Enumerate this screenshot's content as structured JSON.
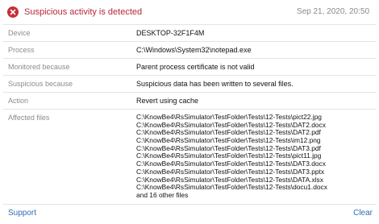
{
  "alert": {
    "title": "Suspicious activity is detected",
    "timestamp": "Sep 21, 2020, 20:50",
    "icon": "error-x-icon",
    "accent_color": "#c62f3a"
  },
  "details": {
    "device": {
      "label": "Device",
      "value": "DESKTOP-32F1F4M"
    },
    "process": {
      "label": "Process",
      "value": "C:\\Windows\\System32\\notepad.exe"
    },
    "monitored": {
      "label": "Monitored because",
      "value": "Parent process certificate is not valid"
    },
    "suspicious": {
      "label": "Suspicious because",
      "value": "Suspicious data has been written to several files."
    },
    "action": {
      "label": "Action",
      "value": "Revert using cache"
    },
    "affected": {
      "label": "Affected files",
      "files": [
        "C:\\KnowBe4\\RsSimulator\\TestFolder\\Tests\\12-Tests\\pict22.jpg",
        "C:\\KnowBe4\\RsSimulator\\TestFolder\\Tests\\12-Tests\\DAT2.docx",
        "C:\\KnowBe4\\RsSimulator\\TestFolder\\Tests\\12-Tests\\DAT2.pdf",
        "C:\\KnowBe4\\RsSimulator\\TestFolder\\Tests\\12-Tests\\im12.png",
        "C:\\KnowBe4\\RsSimulator\\TestFolder\\Tests\\12-Tests\\DAT3.pdf",
        "C:\\KnowBe4\\RsSimulator\\TestFolder\\Tests\\12-Tests\\pict11.jpg",
        "C:\\KnowBe4\\RsSimulator\\TestFolder\\Tests\\12-Tests\\DAT3.docx",
        "C:\\KnowBe4\\RsSimulator\\TestFolder\\Tests\\12-Tests\\DAT3.pptx",
        "C:\\KnowBe4\\RsSimulator\\TestFolder\\Tests\\12-Tests\\DATA.xlsx",
        "C:\\KnowBe4\\RsSimulator\\TestFolder\\Tests\\12-Tests\\docu1.docx",
        "and 16 other files"
      ]
    }
  },
  "footer": {
    "support_label": "Support",
    "clear_label": "Clear",
    "link_color": "#2f6db3"
  }
}
